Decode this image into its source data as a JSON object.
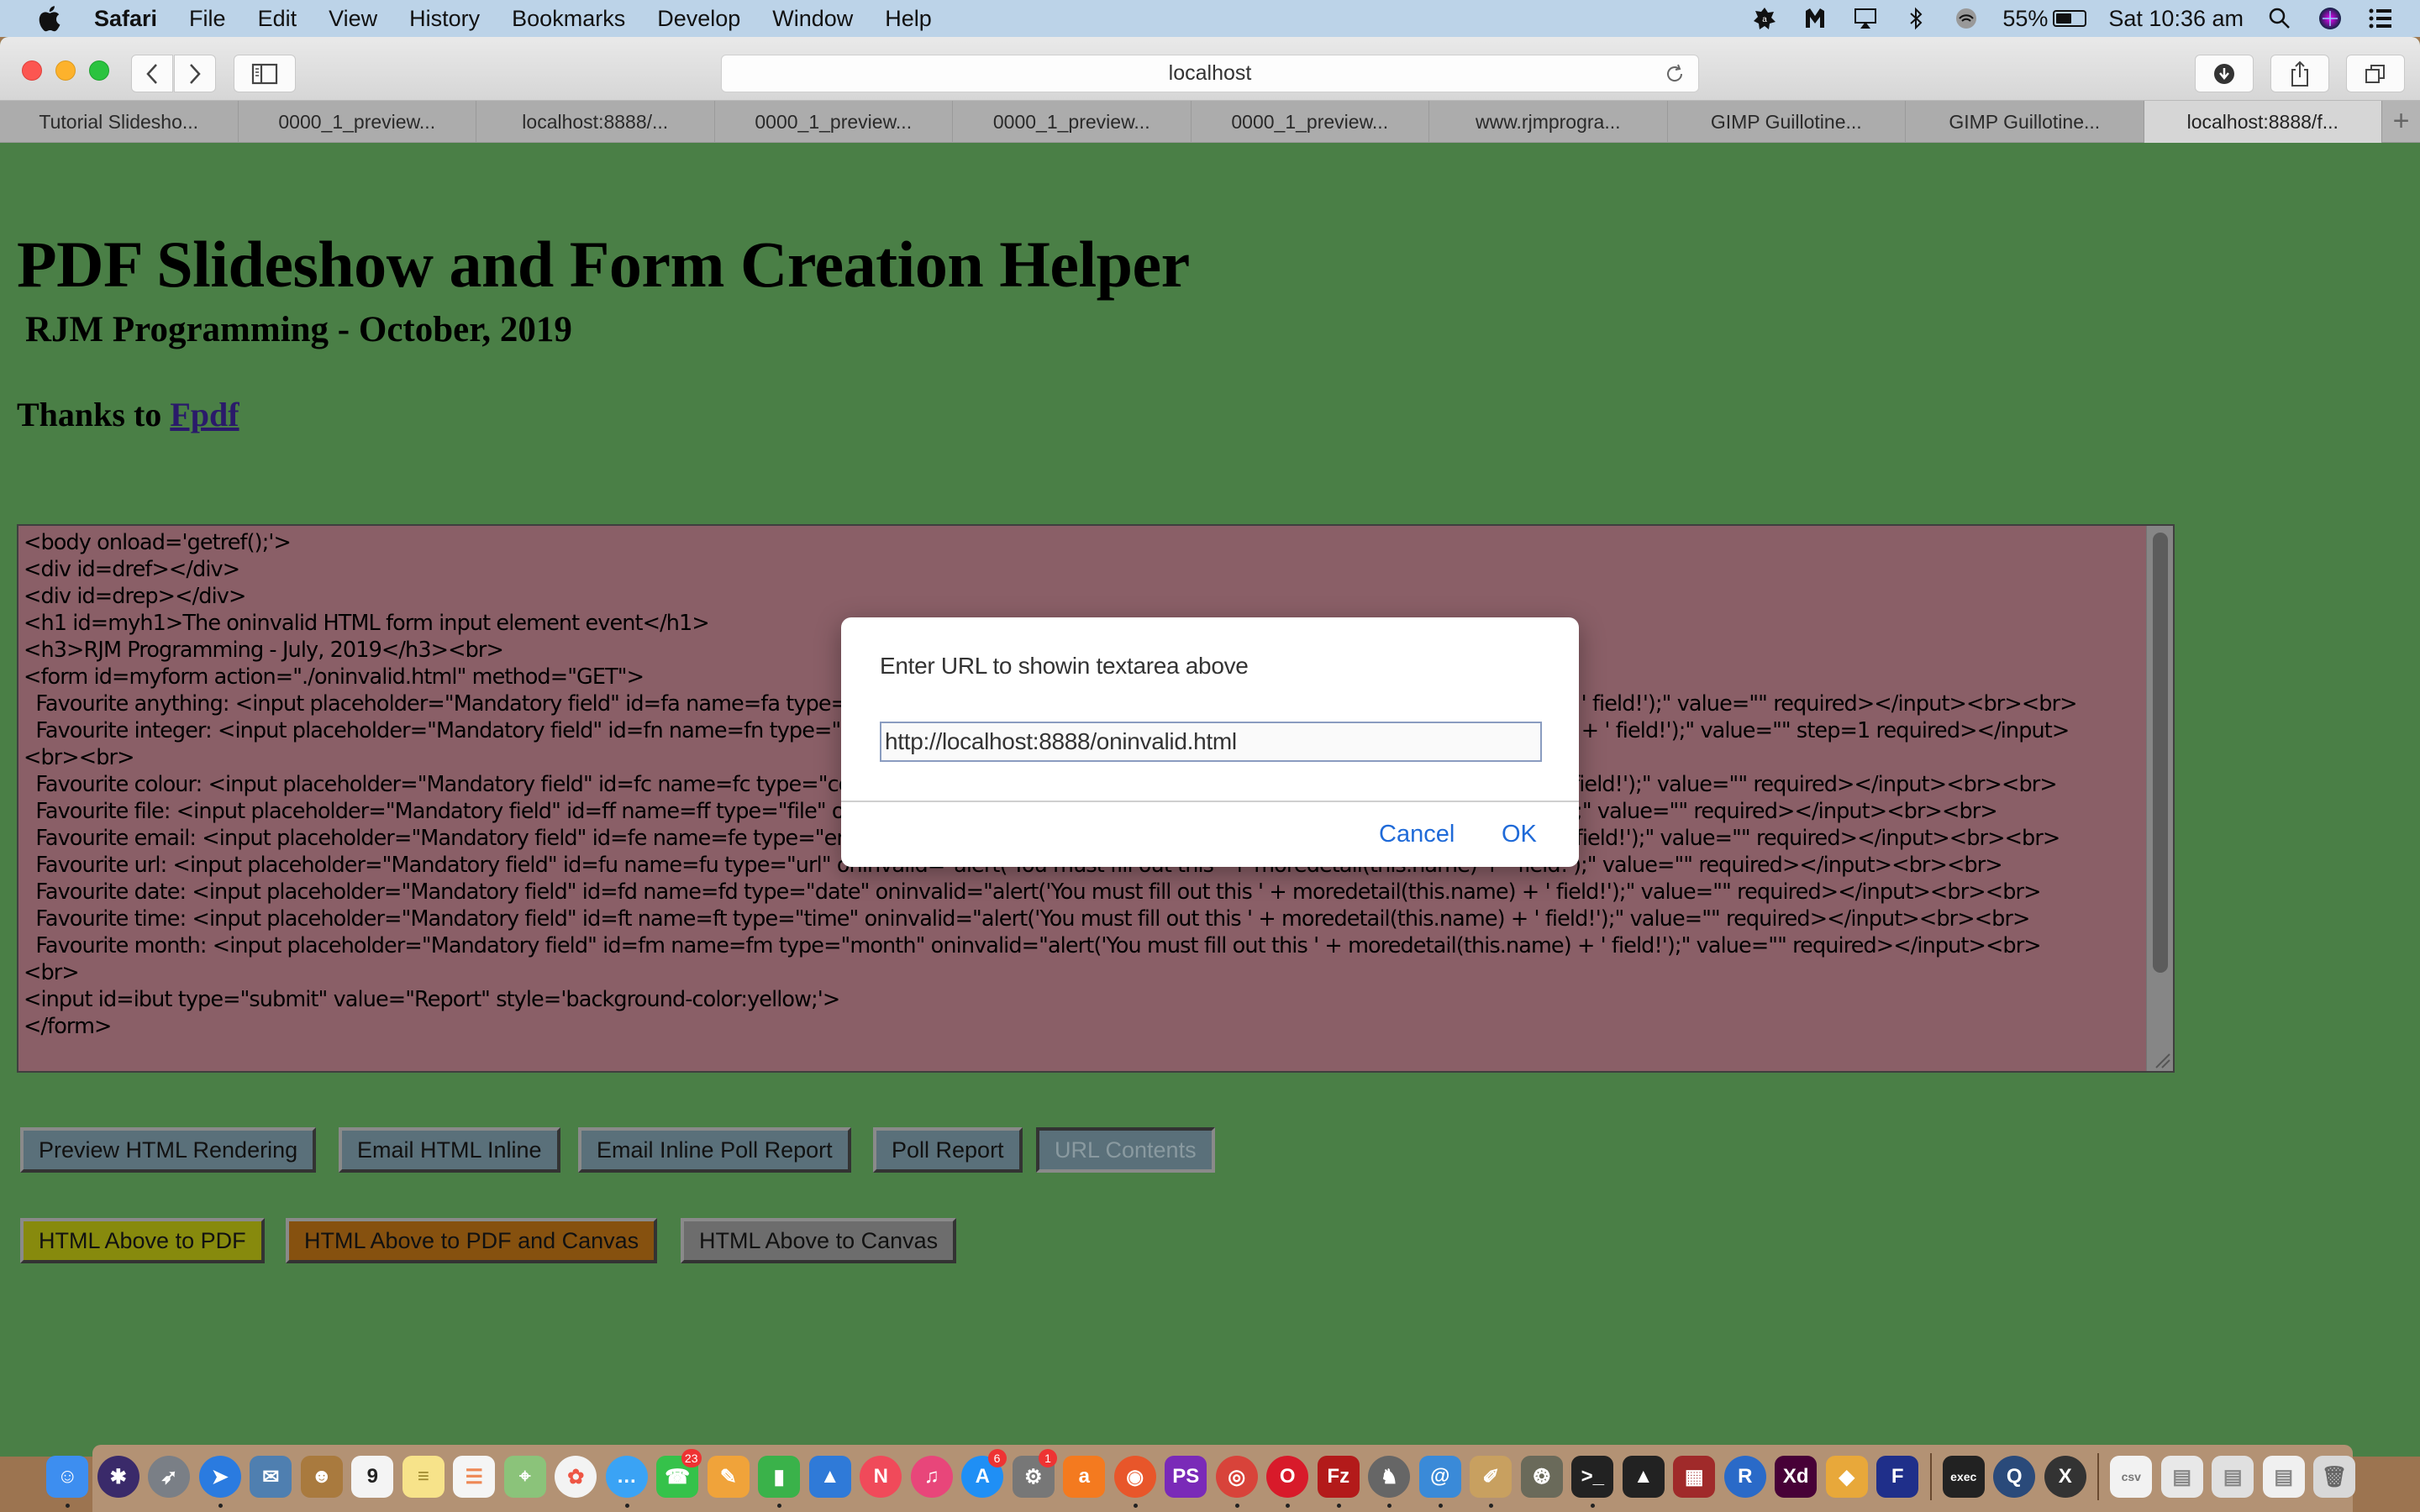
{
  "menubar": {
    "app_name": "Safari",
    "items": [
      "File",
      "Edit",
      "View",
      "History",
      "Bookmarks",
      "Develop",
      "Window",
      "Help"
    ],
    "battery_percent_label": "55%",
    "battery_level": 0.55,
    "clock": "Sat 10:36 am",
    "status_icons": [
      "avast-icon",
      "malwarebytes-icon",
      "airplay-icon",
      "bluetooth-icon",
      "wifi-icon"
    ]
  },
  "browser": {
    "address": "localhost",
    "tabs": [
      {
        "label": "Tutorial Slidesho...",
        "active": false
      },
      {
        "label": "0000_1_preview...",
        "active": false
      },
      {
        "label": "localhost:8888/...",
        "active": false
      },
      {
        "label": "0000_1_preview...",
        "active": false
      },
      {
        "label": "0000_1_preview...",
        "active": false
      },
      {
        "label": "0000_1_preview...",
        "active": false
      },
      {
        "label": "www.rjmprogra...",
        "active": false
      },
      {
        "label": "GIMP Guillotine...",
        "active": false
      },
      {
        "label": "GIMP Guillotine...",
        "active": false
      },
      {
        "label": "localhost:8888/f...",
        "active": true
      }
    ],
    "new_tab_label": "+"
  },
  "page": {
    "title": "PDF Slideshow and Form Creation Helper",
    "subtitle": "RJM Programming - October, 2019",
    "thanks_prefix": "Thanks to ",
    "thanks_link": "Fpdf",
    "textarea_content": "<body onload='getref();'>\n<div id=dref></div>\n<div id=drep></div>\n<h1 id=myh1>The oninvalid HTML form input element event</h1>\n<h3>RJM Programming - July, 2019</h3><br>\n<form id=myform action=\"./oninvalid.html\" method=\"GET\">\n  Favourite anything: <input placeholder=\"Mandatory field\" id=fa name=fa type=\"text\" oninvalid=\"alert('You must fill out this ' + moredetail(this.name) + ' field!');\" value=\"\" required></input><br><br>\n  Favourite integer: <input placeholder=\"Mandatory field\" id=fn name=fn type=\"number\" oninvalid=\"alert('You must fill out this ' + moredetail(this.name) + ' field!');\" value=\"\" step=1 required></input>\n<br><br>\n  Favourite colour: <input placeholder=\"Mandatory field\" id=fc name=fc type=\"color\" oninvalid=\"alert('You must fill out this ' + moredetail(this.name) + ' field!');\" value=\"\" required></input><br><br>\n  Favourite file: <input placeholder=\"Mandatory field\" id=ff name=ff type=\"file\" oninvalid=\"alert('You must fill out this ' + moredetail(this.name) + ' field!');\" value=\"\" required></input><br><br>\n  Favourite email: <input placeholder=\"Mandatory field\" id=fe name=fe type=\"email\" oninvalid=\"alert('You must fill out this ' + moredetail(this.name) + ' field!');\" value=\"\" required></input><br><br>\n  Favourite url: <input placeholder=\"Mandatory field\" id=fu name=fu type=\"url\" oninvalid=\"alert('You must fill out this ' + moredetail(this.name) + ' field!');\" value=\"\" required></input><br><br>\n  Favourite date: <input placeholder=\"Mandatory field\" id=fd name=fd type=\"date\" oninvalid=\"alert('You must fill out this ' + moredetail(this.name) + ' field!');\" value=\"\" required></input><br><br>\n  Favourite time: <input placeholder=\"Mandatory field\" id=ft name=ft type=\"time\" oninvalid=\"alert('You must fill out this ' + moredetail(this.name) + ' field!');\" value=\"\" required></input><br><br>\n  Favourite month: <input placeholder=\"Mandatory field\" id=fm name=fm type=\"month\" oninvalid=\"alert('You must fill out this ' + moredetail(this.name) + ' field!');\" value=\"\" required></input><br>\n<br>\n<input id=ibut type=\"submit\" value=\"Report\" style='background-color:yellow;'>\n</form>",
    "buttons_row1": [
      {
        "label": "Preview HTML Rendering",
        "style": "blue",
        "enabled": true
      },
      {
        "label": "Email HTML Inline",
        "style": "blue",
        "enabled": true
      },
      {
        "label": "Email Inline Poll Report",
        "style": "blue",
        "enabled": true
      },
      {
        "label": "Poll Report",
        "style": "blue",
        "enabled": true
      },
      {
        "label": "URL Contents",
        "style": "blue",
        "enabled": false
      }
    ],
    "buttons_row2": [
      {
        "label": "HTML Above to PDF",
        "style": "olive",
        "enabled": true
      },
      {
        "label": "HTML Above to PDF and Canvas",
        "style": "orange",
        "enabled": true
      },
      {
        "label": "HTML Above to Canvas",
        "style": "grey",
        "enabled": true
      }
    ],
    "colors": {
      "page_background": "#4a7f46",
      "textarea_background": "#8a5f67",
      "button_blue": "#5a707a",
      "button_olive": "#878a0d",
      "button_orange": "#86510f",
      "button_grey": "#6d6d6d",
      "link": "#2a1a6a",
      "dialog_action": "#1f6ad8"
    }
  },
  "dialog": {
    "message": "Enter URL to showin textarea above",
    "input_value": "http://localhost:8888/oninvalid.html",
    "cancel_label": "Cancel",
    "ok_label": "OK"
  },
  "dock": {
    "apps": [
      {
        "name": "finder",
        "glyph": "☺",
        "color": "#3d8ef0",
        "running": true
      },
      {
        "name": "siri",
        "glyph": "✱",
        "color": "#3a2a6a",
        "round": true
      },
      {
        "name": "launchpad",
        "glyph": "➶",
        "color": "#7a7f86",
        "round": true
      },
      {
        "name": "safari",
        "glyph": "➤",
        "color": "#2a7be0",
        "round": true,
        "running": true
      },
      {
        "name": "mail",
        "glyph": "✉",
        "color": "#4f7fb0"
      },
      {
        "name": "contacts",
        "glyph": "☻",
        "color": "#a97a3e"
      },
      {
        "name": "calendar",
        "glyph": "9",
        "color": "#f4f4f4",
        "text_color": "#222"
      },
      {
        "name": "notes",
        "glyph": "≡",
        "color": "#f7e38a",
        "text_color": "#a08a30"
      },
      {
        "name": "reminders",
        "glyph": "☰",
        "color": "#f5f5f5",
        "text_color": "#e85"
      },
      {
        "name": "maps",
        "glyph": "⌖",
        "color": "#8bc37a"
      },
      {
        "name": "photos",
        "glyph": "✿",
        "color": "#f3f3f3",
        "text_color": "#e54",
        "round": true
      },
      {
        "name": "messages",
        "glyph": "…",
        "color": "#3aa3f5",
        "round": true,
        "running": true
      },
      {
        "name": "facetime",
        "glyph": "☎",
        "color": "#35c24a",
        "badge": "23"
      },
      {
        "name": "pages",
        "glyph": "✎",
        "color": "#f0a33a"
      },
      {
        "name": "numbers",
        "glyph": "▮",
        "color": "#3ab24a",
        "running": true
      },
      {
        "name": "keynote",
        "glyph": "▲",
        "color": "#2f7ad8"
      },
      {
        "name": "news",
        "glyph": "N",
        "color": "#f04a5a",
        "round": true
      },
      {
        "name": "itunes",
        "glyph": "♫",
        "color": "#e8467a",
        "round": true
      },
      {
        "name": "app-store",
        "glyph": "A",
        "color": "#1f8ff5",
        "round": true,
        "badge": "6"
      },
      {
        "name": "system-preferences",
        "glyph": "⚙",
        "color": "#777",
        "badge": "1"
      },
      {
        "name": "avast",
        "glyph": "a",
        "color": "#f47a1f"
      },
      {
        "name": "firefox",
        "glyph": "◉",
        "color": "#e8562a",
        "round": true,
        "running": true
      },
      {
        "name": "phpstorm",
        "glyph": "PS",
        "color": "#7a2ab8"
      },
      {
        "name": "chrome",
        "glyph": "◎",
        "color": "#d8433a",
        "round": true,
        "running": true
      },
      {
        "name": "opera",
        "glyph": "O",
        "color": "#d81a2a",
        "round": true,
        "running": true
      },
      {
        "name": "filezilla",
        "glyph": "Fz",
        "color": "#b31a1a",
        "running": true
      },
      {
        "name": "mamp",
        "glyph": "♞",
        "color": "#666",
        "round": true,
        "running": true
      },
      {
        "name": "coda",
        "glyph": "@",
        "color": "#3a8ad8",
        "running": true
      },
      {
        "name": "text-editor",
        "glyph": "✐",
        "color": "#c8a060",
        "running": true
      },
      {
        "name": "gimp",
        "glyph": "❂",
        "color": "#6a6a5a"
      },
      {
        "name": "terminal",
        "glyph": ">_",
        "color": "#222",
        "running": true
      },
      {
        "name": "inkscape",
        "glyph": "▲",
        "color": "#222"
      },
      {
        "name": "photo-booth",
        "glyph": "▦",
        "color": "#a02a2a"
      },
      {
        "name": "r",
        "glyph": "R",
        "color": "#2a6ac8",
        "round": true
      },
      {
        "name": "adobe-xd",
        "glyph": "Xd",
        "color": "#470137"
      },
      {
        "name": "sketch",
        "glyph": "◆",
        "color": "#e8a83a"
      },
      {
        "name": "flowchart",
        "glyph": "F",
        "color": "#1f2f8a"
      },
      {
        "name": "exec",
        "glyph": "exec",
        "color": "#222",
        "separator_before": true
      },
      {
        "name": "quicktime",
        "glyph": "Q",
        "color": "#2a4a7a",
        "round": true
      },
      {
        "name": "xquartz",
        "glyph": "X",
        "color": "#333",
        "round": true
      },
      {
        "name": "document-csv",
        "glyph": "csv",
        "color": "#f2f2f2",
        "text_color": "#777",
        "separator_before": true
      },
      {
        "name": "downloaded-file-1",
        "glyph": "▤",
        "color": "#e8e8e8",
        "text_color": "#888"
      },
      {
        "name": "downloaded-file-2",
        "glyph": "▤",
        "color": "#e0e0e0",
        "text_color": "#888"
      },
      {
        "name": "downloaded-file-3",
        "glyph": "▤",
        "color": "#f0f0f0",
        "text_color": "#888"
      },
      {
        "name": "trash",
        "glyph": "🗑",
        "color": "#d8d8d8",
        "text_color": "#666"
      }
    ]
  }
}
